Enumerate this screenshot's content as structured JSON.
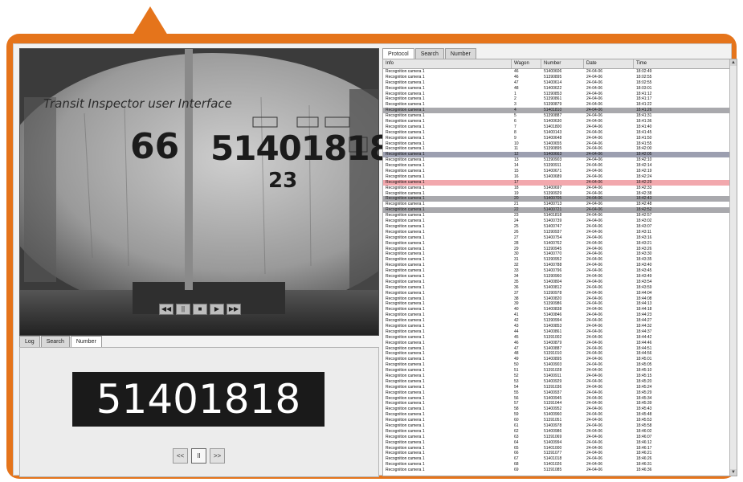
{
  "video": {
    "overlay_title": "Transit Inspector user Interface",
    "train_number_left": "66",
    "train_number_main": "51401818",
    "train_number_sub": "23",
    "controls": [
      "◀◀",
      "||",
      "■",
      "▶",
      "▶▶"
    ]
  },
  "left_tabs": [
    "Log",
    "Search",
    "Number"
  ],
  "left_tab_active": 2,
  "plate_number": "51401818",
  "plate_controls": {
    "prev": "<<",
    "mid": "II",
    "next": ">>"
  },
  "right_tabs": [
    "Protocol",
    "Search",
    "Number"
  ],
  "right_tab_active": 0,
  "table": {
    "headers": [
      "Info",
      "Wagon",
      "Number",
      "Date",
      "Time"
    ],
    "rows": [
      {
        "info": "Recognition camera 1",
        "wagon": "46",
        "number": "51400606",
        "date": "24-04-06",
        "time": "18:02:49",
        "hl": ""
      },
      {
        "info": "Recognition camera 1",
        "wagon": "46",
        "number": "51390895",
        "date": "24-04-06",
        "time": "18:02:55",
        "hl": ""
      },
      {
        "info": "Recognition camera 1",
        "wagon": "47",
        "number": "51400614",
        "date": "24-04-06",
        "time": "18:02:55",
        "hl": ""
      },
      {
        "info": "Recognition camera 1",
        "wagon": "48",
        "number": "51400622",
        "date": "24-04-06",
        "time": "18:03:01",
        "hl": ""
      },
      {
        "info": "Recognition camera 1",
        "wagon": "1",
        "number": "51390853",
        "date": "24-04-06",
        "time": "18:41:12",
        "hl": ""
      },
      {
        "info": "Recognition camera 1",
        "wagon": "2",
        "number": "51390861",
        "date": "24-04-06",
        "time": "18:41:17",
        "hl": ""
      },
      {
        "info": "Recognition camera 1",
        "wagon": "3",
        "number": "51390879",
        "date": "24-04-06",
        "time": "18:41:22",
        "hl": ""
      },
      {
        "info": "Recognition camera 1",
        "wagon": "4",
        "number": "51401810",
        "date": "24-04-06",
        "time": "18:41:26",
        "hl": "gray"
      },
      {
        "info": "Recognition camera 1",
        "wagon": "5",
        "number": "51390887",
        "date": "24-04-06",
        "time": "18:41:31",
        "hl": ""
      },
      {
        "info": "Recognition camera 1",
        "wagon": "6",
        "number": "51400630",
        "date": "24-04-06",
        "time": "18:41:36",
        "hl": ""
      },
      {
        "info": "Recognition camera 1",
        "wagon": "7",
        "number": "51401800",
        "date": "24-04-06",
        "time": "18:41:40",
        "hl": ""
      },
      {
        "info": "Recognition camera 1",
        "wagon": "8",
        "number": "51400143",
        "date": "24-04-06",
        "time": "18:41:45",
        "hl": ""
      },
      {
        "info": "Recognition camera 1",
        "wagon": "9",
        "number": "51400648",
        "date": "24-04-06",
        "time": "18:41:50",
        "hl": ""
      },
      {
        "info": "Recognition camera 1",
        "wagon": "10",
        "number": "51400655",
        "date": "24-04-06",
        "time": "18:41:55",
        "hl": ""
      },
      {
        "info": "Recognition camera 1",
        "wagon": "11",
        "number": "51390895",
        "date": "24-04-06",
        "time": "18:42:00",
        "hl": ""
      },
      {
        "info": "Recognition camera 1",
        "wagon": "12",
        "number": "51400663",
        "date": "24-04-06",
        "time": "18:42:05",
        "hl": "blue"
      },
      {
        "info": "Recognition camera 1",
        "wagon": "13",
        "number": "51390903",
        "date": "24-04-06",
        "time": "18:42:10",
        "hl": ""
      },
      {
        "info": "Recognition camera 1",
        "wagon": "14",
        "number": "51390911",
        "date": "24-04-06",
        "time": "18:42:14",
        "hl": ""
      },
      {
        "info": "Recognition camera 1",
        "wagon": "15",
        "number": "51400671",
        "date": "24-04-06",
        "time": "18:42:19",
        "hl": ""
      },
      {
        "info": "Recognition camera 1",
        "wagon": "16",
        "number": "51400689",
        "date": "24-04-06",
        "time": "18:42:24",
        "hl": ""
      },
      {
        "info": "Recognition camera 1",
        "wagon": "17",
        "number": "",
        "date": "24-04-06",
        "time": "18:42:29",
        "hl": "red"
      },
      {
        "info": "Recognition camera 1",
        "wagon": "18",
        "number": "51400697",
        "date": "24-04-06",
        "time": "18:42:33",
        "hl": ""
      },
      {
        "info": "Recognition camera 1",
        "wagon": "19",
        "number": "51390929",
        "date": "24-04-06",
        "time": "18:42:38",
        "hl": ""
      },
      {
        "info": "Recognition camera 1",
        "wagon": "20",
        "number": "51400705",
        "date": "24-04-06",
        "time": "18:42:43",
        "hl": "gray"
      },
      {
        "info": "Recognition camera 1",
        "wagon": "21",
        "number": "51400713",
        "date": "24-04-06",
        "time": "18:42:48",
        "hl": ""
      },
      {
        "info": "Recognition camera 1",
        "wagon": "22",
        "number": "51400721",
        "date": "24-04-06",
        "time": "18:42:52",
        "hl": "gray"
      },
      {
        "info": "Recognition camera 1",
        "wagon": "23",
        "number": "51401818",
        "date": "24-04-06",
        "time": "18:42:57",
        "hl": ""
      },
      {
        "info": "Recognition camera 1",
        "wagon": "24",
        "number": "51400739",
        "date": "24-04-06",
        "time": "18:43:02",
        "hl": ""
      },
      {
        "info": "Recognition camera 1",
        "wagon": "25",
        "number": "51400747",
        "date": "24-04-06",
        "time": "18:43:07",
        "hl": ""
      },
      {
        "info": "Recognition camera 1",
        "wagon": "26",
        "number": "51390937",
        "date": "24-04-06",
        "time": "18:43:11",
        "hl": ""
      },
      {
        "info": "Recognition camera 1",
        "wagon": "27",
        "number": "51400754",
        "date": "24-04-06",
        "time": "18:43:16",
        "hl": ""
      },
      {
        "info": "Recognition camera 1",
        "wagon": "28",
        "number": "51400762",
        "date": "24-04-06",
        "time": "18:43:21",
        "hl": ""
      },
      {
        "info": "Recognition camera 1",
        "wagon": "29",
        "number": "51390945",
        "date": "24-04-06",
        "time": "18:43:26",
        "hl": ""
      },
      {
        "info": "Recognition camera 1",
        "wagon": "30",
        "number": "51400770",
        "date": "24-04-06",
        "time": "18:43:30",
        "hl": ""
      },
      {
        "info": "Recognition camera 1",
        "wagon": "31",
        "number": "51390952",
        "date": "24-04-06",
        "time": "18:43:35",
        "hl": ""
      },
      {
        "info": "Recognition camera 1",
        "wagon": "32",
        "number": "51400788",
        "date": "24-04-06",
        "time": "18:43:40",
        "hl": ""
      },
      {
        "info": "Recognition camera 1",
        "wagon": "33",
        "number": "51400796",
        "date": "24-04-06",
        "time": "18:43:45",
        "hl": ""
      },
      {
        "info": "Recognition camera 1",
        "wagon": "34",
        "number": "51390960",
        "date": "24-04-06",
        "time": "18:43:49",
        "hl": ""
      },
      {
        "info": "Recognition camera 1",
        "wagon": "35",
        "number": "51400804",
        "date": "24-04-06",
        "time": "18:43:54",
        "hl": ""
      },
      {
        "info": "Recognition camera 1",
        "wagon": "36",
        "number": "51400812",
        "date": "24-04-06",
        "time": "18:43:59",
        "hl": ""
      },
      {
        "info": "Recognition camera 1",
        "wagon": "37",
        "number": "51390978",
        "date": "24-04-06",
        "time": "18:44:04",
        "hl": ""
      },
      {
        "info": "Recognition camera 1",
        "wagon": "38",
        "number": "51400820",
        "date": "24-04-06",
        "time": "18:44:08",
        "hl": ""
      },
      {
        "info": "Recognition camera 1",
        "wagon": "39",
        "number": "51390986",
        "date": "24-04-06",
        "time": "18:44:13",
        "hl": ""
      },
      {
        "info": "Recognition camera 1",
        "wagon": "40",
        "number": "51400838",
        "date": "24-04-06",
        "time": "18:44:18",
        "hl": ""
      },
      {
        "info": "Recognition camera 1",
        "wagon": "41",
        "number": "51400846",
        "date": "24-04-06",
        "time": "18:44:23",
        "hl": ""
      },
      {
        "info": "Recognition camera 1",
        "wagon": "42",
        "number": "51390994",
        "date": "24-04-06",
        "time": "18:44:27",
        "hl": ""
      },
      {
        "info": "Recognition camera 1",
        "wagon": "43",
        "number": "51400853",
        "date": "24-04-06",
        "time": "18:44:32",
        "hl": ""
      },
      {
        "info": "Recognition camera 1",
        "wagon": "44",
        "number": "51400861",
        "date": "24-04-06",
        "time": "18:44:37",
        "hl": ""
      },
      {
        "info": "Recognition camera 1",
        "wagon": "45",
        "number": "51391002",
        "date": "24-04-06",
        "time": "18:44:42",
        "hl": ""
      },
      {
        "info": "Recognition camera 1",
        "wagon": "46",
        "number": "51400879",
        "date": "24-04-06",
        "time": "18:44:46",
        "hl": ""
      },
      {
        "info": "Recognition camera 1",
        "wagon": "47",
        "number": "51400887",
        "date": "24-04-06",
        "time": "18:44:51",
        "hl": ""
      },
      {
        "info": "Recognition camera 1",
        "wagon": "48",
        "number": "51391010",
        "date": "24-04-06",
        "time": "18:44:56",
        "hl": ""
      },
      {
        "info": "Recognition camera 1",
        "wagon": "49",
        "number": "51400895",
        "date": "24-04-06",
        "time": "18:45:01",
        "hl": ""
      },
      {
        "info": "Recognition camera 1",
        "wagon": "50",
        "number": "51400903",
        "date": "24-04-06",
        "time": "18:45:05",
        "hl": ""
      },
      {
        "info": "Recognition camera 1",
        "wagon": "51",
        "number": "51391028",
        "date": "24-04-06",
        "time": "18:45:10",
        "hl": ""
      },
      {
        "info": "Recognition camera 1",
        "wagon": "52",
        "number": "51400911",
        "date": "24-04-06",
        "time": "18:45:15",
        "hl": ""
      },
      {
        "info": "Recognition camera 1",
        "wagon": "53",
        "number": "51400929",
        "date": "24-04-06",
        "time": "18:45:20",
        "hl": ""
      },
      {
        "info": "Recognition camera 1",
        "wagon": "54",
        "number": "51391036",
        "date": "24-04-06",
        "time": "18:45:24",
        "hl": ""
      },
      {
        "info": "Recognition camera 1",
        "wagon": "55",
        "number": "51400937",
        "date": "24-04-06",
        "time": "18:45:29",
        "hl": ""
      },
      {
        "info": "Recognition camera 1",
        "wagon": "56",
        "number": "51400945",
        "date": "24-04-06",
        "time": "18:45:34",
        "hl": ""
      },
      {
        "info": "Recognition camera 1",
        "wagon": "57",
        "number": "51391044",
        "date": "24-04-06",
        "time": "18:45:39",
        "hl": ""
      },
      {
        "info": "Recognition camera 1",
        "wagon": "58",
        "number": "51400952",
        "date": "24-04-06",
        "time": "18:45:43",
        "hl": ""
      },
      {
        "info": "Recognition camera 1",
        "wagon": "59",
        "number": "51400960",
        "date": "24-04-06",
        "time": "18:45:48",
        "hl": ""
      },
      {
        "info": "Recognition camera 1",
        "wagon": "60",
        "number": "51391051",
        "date": "24-04-06",
        "time": "18:45:53",
        "hl": ""
      },
      {
        "info": "Recognition camera 1",
        "wagon": "61",
        "number": "51400978",
        "date": "24-04-06",
        "time": "18:45:58",
        "hl": ""
      },
      {
        "info": "Recognition camera 1",
        "wagon": "62",
        "number": "51400986",
        "date": "24-04-06",
        "time": "18:46:02",
        "hl": ""
      },
      {
        "info": "Recognition camera 1",
        "wagon": "63",
        "number": "51391069",
        "date": "24-04-06",
        "time": "18:46:07",
        "hl": ""
      },
      {
        "info": "Recognition camera 1",
        "wagon": "64",
        "number": "51400994",
        "date": "24-04-06",
        "time": "18:46:12",
        "hl": ""
      },
      {
        "info": "Recognition camera 1",
        "wagon": "65",
        "number": "51401000",
        "date": "24-04-06",
        "time": "18:46:17",
        "hl": ""
      },
      {
        "info": "Recognition camera 1",
        "wagon": "66",
        "number": "51391077",
        "date": "24-04-06",
        "time": "18:46:21",
        "hl": ""
      },
      {
        "info": "Recognition camera 1",
        "wagon": "67",
        "number": "51401018",
        "date": "24-04-06",
        "time": "18:46:26",
        "hl": ""
      },
      {
        "info": "Recognition camera 1",
        "wagon": "68",
        "number": "51401026",
        "date": "24-04-06",
        "time": "18:46:31",
        "hl": ""
      },
      {
        "info": "Recognition camera 1",
        "wagon": "69",
        "number": "51391085",
        "date": "24-04-06",
        "time": "18:46:36",
        "hl": ""
      },
      {
        "info": "Recognition camera 1",
        "wagon": "70",
        "number": "51401034",
        "date": "24-04-06",
        "time": "18:46:40",
        "hl": ""
      }
    ]
  },
  "colors": {
    "frame": "#e5741b",
    "plate_bg": "#1a1a1a",
    "highlight_red": "#f2a8ad",
    "highlight_gray": "#a9a9ad",
    "highlight_blue": "#9c9fb0"
  }
}
